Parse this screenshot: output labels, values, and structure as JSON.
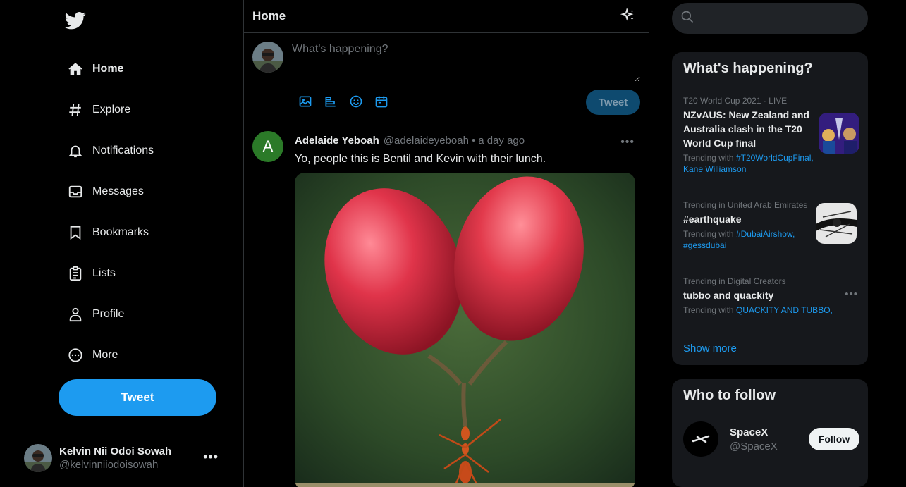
{
  "colors": {
    "accent": "#1d9bf0",
    "background": "#000000",
    "panel": "#16181c",
    "border": "#2f3336",
    "muted": "#71767b"
  },
  "sidebar": {
    "logo": "twitter-bird-icon",
    "items": [
      {
        "label": "Home",
        "icon": "home-icon",
        "active": true
      },
      {
        "label": "Explore",
        "icon": "hashtag-icon"
      },
      {
        "label": "Notifications",
        "icon": "bell-icon"
      },
      {
        "label": "Messages",
        "icon": "envelope-icon"
      },
      {
        "label": "Bookmarks",
        "icon": "bookmark-icon"
      },
      {
        "label": "Lists",
        "icon": "list-icon"
      },
      {
        "label": "Profile",
        "icon": "person-icon"
      },
      {
        "label": "More",
        "icon": "more-circle-icon"
      }
    ],
    "tweet_button": "Tweet",
    "account": {
      "name": "Kelvin Nii Odoi Sowah",
      "handle": "@kelvinniiodoisowah",
      "more": "•••"
    }
  },
  "main": {
    "title": "Home",
    "composer": {
      "placeholder": "What's happening?",
      "submit": "Tweet"
    },
    "tweet": {
      "avatar_letter": "A",
      "name": "Adelaide Yeboah",
      "handle": "@adelaideyeboah",
      "separator": "•",
      "time": "a day ago",
      "text": "Yo, people this is Bentil and Kevin with their lunch.",
      "more": "•••"
    }
  },
  "right": {
    "search": {
      "placeholder": ""
    },
    "trends": {
      "title": "What's happening?",
      "items": [
        {
          "context": "T20 World Cup 2021 · LIVE",
          "topic": "NZvAUS: New Zealand and Australia clash in the T20 World Cup final",
          "prefix": "Trending with ",
          "links": "#T20WorldCupFinal, Kane Williamson"
        },
        {
          "context": "Trending in United Arab Emirates",
          "topic": "#earthquake",
          "prefix": "Trending with ",
          "links": "#DubaiAirshow, #gessdubai"
        },
        {
          "context": "Trending in Digital Creators",
          "topic": "tubbo and quackity",
          "prefix": "Trending with ",
          "links": "QUACKITY AND TUBBO,"
        }
      ],
      "more": "•••",
      "show_more": "Show more"
    },
    "who_to_follow": {
      "title": "Who to follow",
      "accounts": [
        {
          "name": "SpaceX",
          "handle": "@SpaceX",
          "button": "Follow"
        }
      ]
    }
  }
}
